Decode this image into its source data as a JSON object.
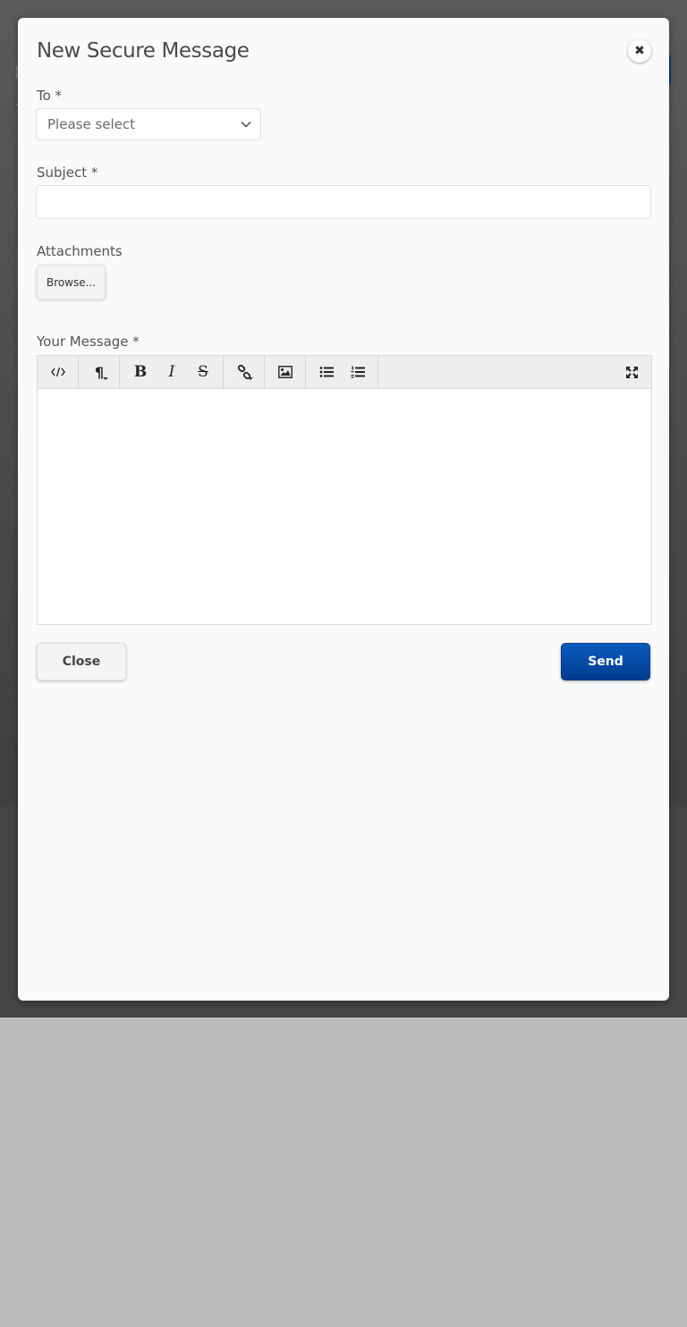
{
  "modal": {
    "title": "New Secure Message",
    "close_icon": "close-icon"
  },
  "to": {
    "label": "To *",
    "placeholder": "Please select"
  },
  "subject": {
    "label": "Subject *",
    "value": ""
  },
  "attachments": {
    "label": "Attachments",
    "browse_label": "Browse..."
  },
  "message": {
    "label": "Your Message *",
    "toolbar": [
      "code-view-icon",
      "paragraph-style-icon",
      "bold-icon",
      "italic-icon",
      "strikethrough-icon",
      "link-icon",
      "image-icon",
      "unordered-list-icon",
      "ordered-list-icon",
      "fullscreen-icon"
    ],
    "value": ""
  },
  "footer": {
    "close_label": "Close",
    "send_label": "Send"
  },
  "colors": {
    "primary": "#0a4fa8",
    "overlay": "#454545",
    "modal_bg": "#fafafa"
  }
}
